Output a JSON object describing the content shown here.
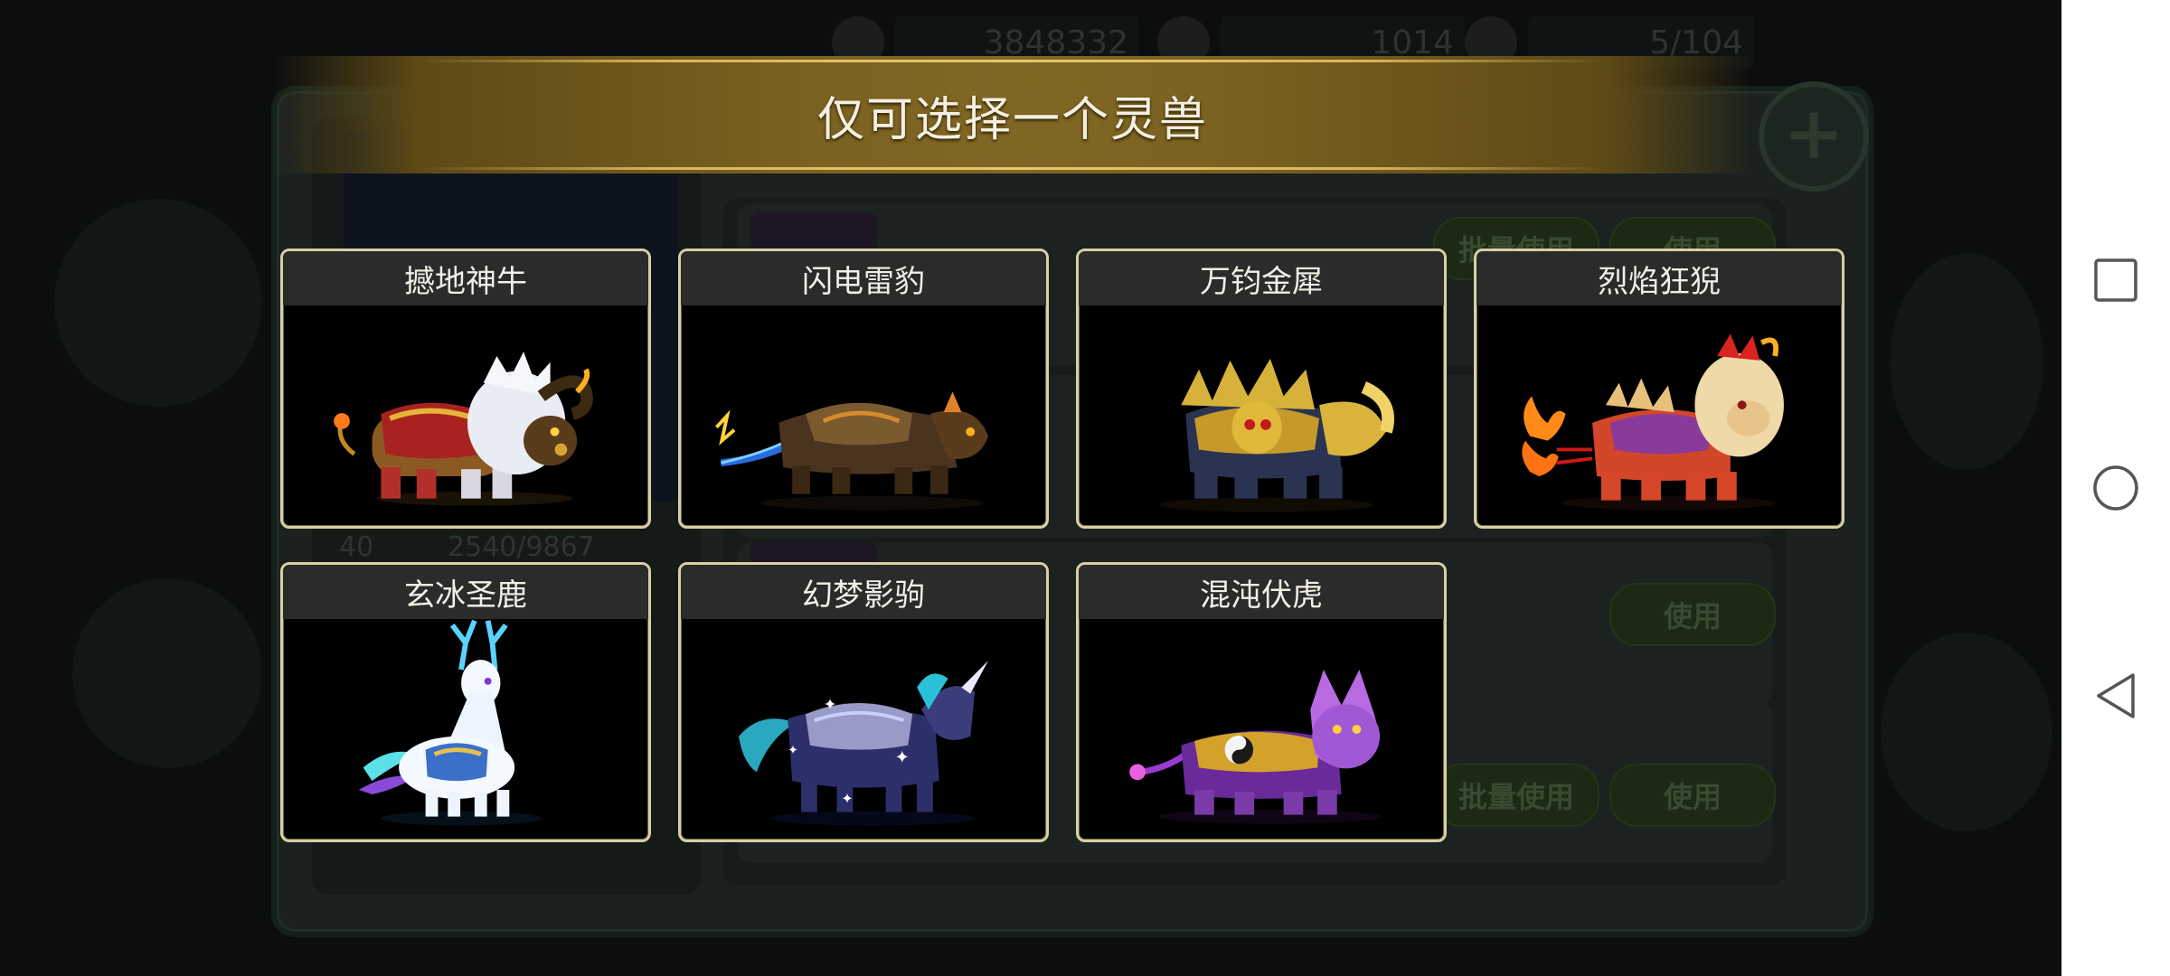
{
  "background": {
    "resources": [
      {
        "name": "coin-icon",
        "value": "3848332"
      },
      {
        "name": "ingot-icon",
        "value": "1014"
      },
      {
        "name": "stamina-icon",
        "value": "5/104"
      }
    ],
    "level": "40",
    "exp": "2540/9867",
    "buttons": {
      "batch_use": "批量使用",
      "use": "使用"
    }
  },
  "modal": {
    "title": "仅可选择一个灵兽",
    "beasts": [
      {
        "name": "撼地神牛",
        "icon": "bull-icon"
      },
      {
        "name": "闪电雷豹",
        "icon": "leopard-icon"
      },
      {
        "name": "万钧金犀",
        "icon": "rhino-icon"
      },
      {
        "name": "烈焰狂猊",
        "icon": "lion-icon"
      },
      {
        "name": "玄冰圣鹿",
        "icon": "deer-icon"
      },
      {
        "name": "幻梦影驹",
        "icon": "unicorn-icon"
      },
      {
        "name": "混沌伏虎",
        "icon": "tiger-icon"
      }
    ]
  },
  "nav": {
    "buttons": [
      {
        "name": "recent-apps",
        "icon": "square-icon"
      },
      {
        "name": "home",
        "icon": "circle-icon"
      },
      {
        "name": "back",
        "icon": "triangle-icon"
      }
    ]
  },
  "colors": {
    "banner_gold": "#806724",
    "card_border": "#d7d0a6",
    "card_header": "#2b2b2b",
    "title_text": "#f4efe2"
  }
}
